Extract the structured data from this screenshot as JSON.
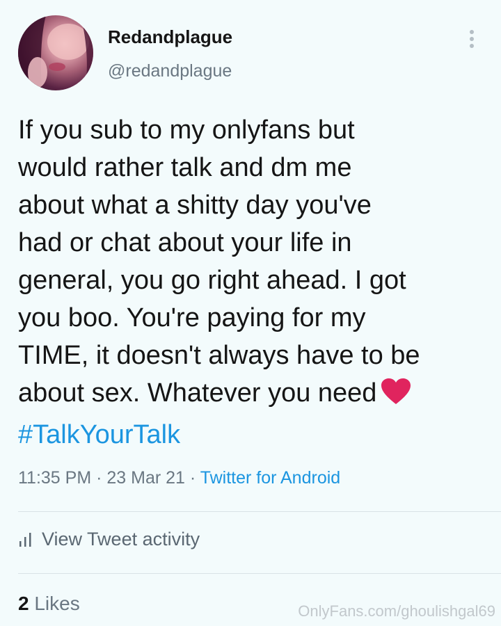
{
  "profile": {
    "display_name": "Redandplague",
    "handle": "@redandplague"
  },
  "tweet": {
    "text": "If you sub to my onlyfans but\nwould rather talk and dm me\nabout what a shitty day you've\nhad or chat about your life in\ngeneral, you go right ahead. I got\nyou boo. You're paying for my\nTIME, it doesn't always have to be\nabout sex. Whatever you need",
    "emoji": "heart-icon",
    "hashtag": "#TalkYourTalk"
  },
  "meta": {
    "time": "11:35 PM",
    "separator": " · ",
    "date": "23 Mar 21",
    "source": "Twitter for Android"
  },
  "actions": {
    "activity_label": "View Tweet activity",
    "likes_count": "2",
    "likes_label": "Likes"
  },
  "watermark": "OnlyFans.com/ghoulishgal69",
  "colors": {
    "background": "#f3fbfc",
    "link": "#1b95e0",
    "muted": "#6a7782",
    "heart": "#e0245e"
  }
}
